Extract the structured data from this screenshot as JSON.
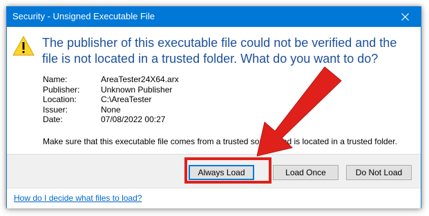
{
  "window": {
    "title": "Security - Unsigned Executable File"
  },
  "message": {
    "headline": "The publisher of this executable file could not be verified and the file is not located in a trusted folder. What do you want to do?",
    "advice": "Make sure that this executable file comes from a trusted source and is located in a trusted folder."
  },
  "details": [
    {
      "label": "Name:",
      "value": "AreaTester24X64.arx"
    },
    {
      "label": "Publisher:",
      "value": "Unknown Publisher"
    },
    {
      "label": "Location:",
      "value": "C:\\AreaTester"
    },
    {
      "label": "Issuer:",
      "value": "None"
    },
    {
      "label": "Date:",
      "value": "07/08/2022  00:27"
    }
  ],
  "buttons": {
    "always_load": "Always Load",
    "load_once": "Load Once",
    "do_not_load": "Do Not Load"
  },
  "footer": {
    "help_link": "How do I decide what files to load?"
  },
  "icons": {
    "warning": "warning-triangle-icon",
    "close": "close-icon"
  },
  "colors": {
    "titlebar": "#0078d7",
    "headline": "#1b4f9c",
    "annotation": "#e0201a",
    "link": "#0066cc"
  }
}
